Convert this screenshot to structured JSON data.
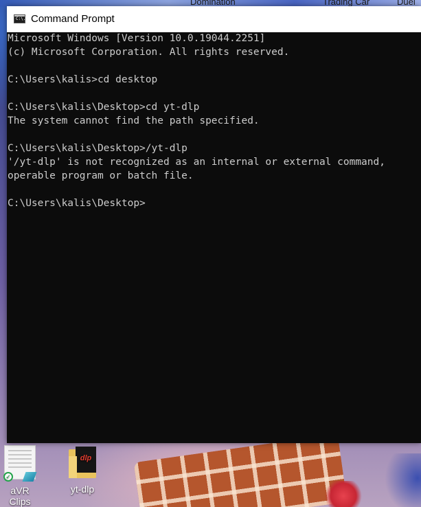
{
  "desktop": {
    "top_labels": [
      "Domination",
      "Trading Car",
      "Duel"
    ],
    "icons": [
      {
        "label": "aVR Clips",
        "icon": "document-icon"
      },
      {
        "label": "yt-dlp",
        "icon": "folder-icon",
        "badge": "dlp"
      }
    ]
  },
  "window": {
    "title": "Command Prompt",
    "icon_text": "C:\\."
  },
  "console": {
    "lines": [
      "Microsoft Windows [Version 10.0.19044.2251]",
      "(c) Microsoft Corporation. All rights reserved.",
      "",
      "C:\\Users\\kalis>cd desktop",
      "",
      "C:\\Users\\kalis\\Desktop>cd yt-dlp",
      "The system cannot find the path specified.",
      "",
      "C:\\Users\\kalis\\Desktop>/yt-dlp",
      "'/yt-dlp' is not recognized as an internal or external command,",
      "operable program or batch file.",
      ""
    ],
    "prompt": "C:\\Users\\kalis\\Desktop>"
  }
}
